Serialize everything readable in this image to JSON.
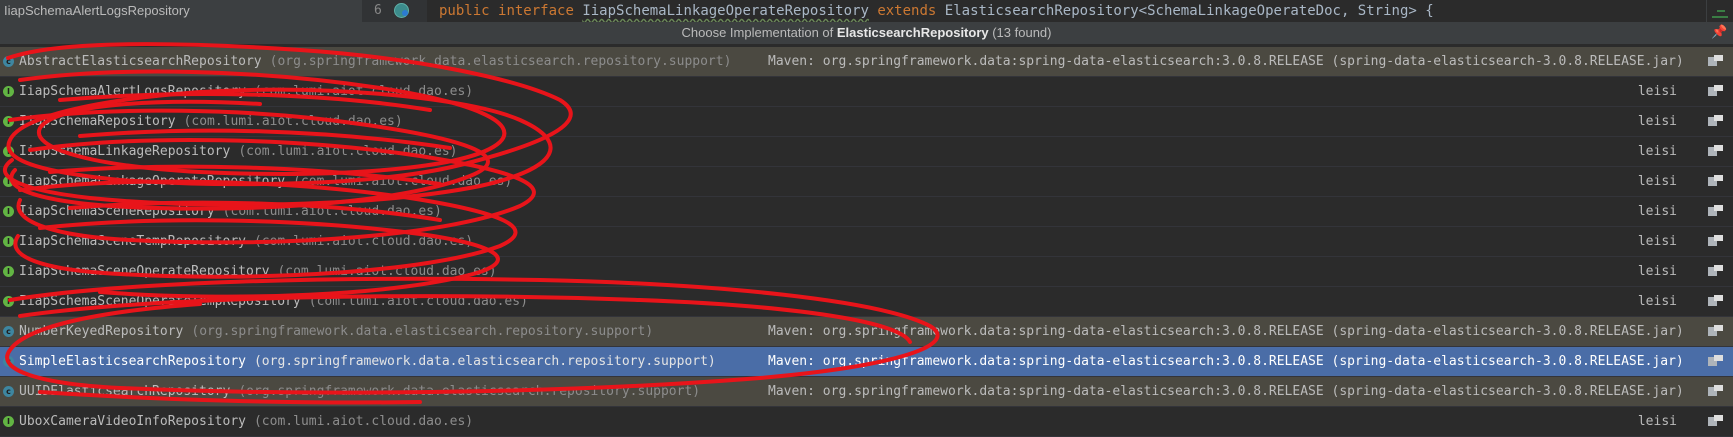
{
  "editor": {
    "file_tab": "IiapSchemaAlertLogsRepository",
    "line_number": "6",
    "code": {
      "kw1": "public",
      "kw2": "interface",
      "interface_name": "IiapSchemaLinkageOperateRepository",
      "kw3": "extends",
      "parent": "ElasticsearchRepository",
      "generic": "<SchemaLinkageOperateDoc, String>",
      "brace": " {"
    }
  },
  "popup": {
    "title_prefix": "Choose Implementation of ",
    "title_target": "ElasticsearchRepository",
    "title_count": " (13 found)"
  },
  "rows": [
    {
      "kind": "class",
      "name": "AbstractElasticsearchRepository",
      "pkg": "(org.springframework.data.elasticsearch.repository.support)",
      "location": "Maven: org.springframework.data:spring-data-elasticsearch:3.0.8.RELEASE (spring-data-elasticsearch-3.0.8.RELEASE.jar)",
      "library": true,
      "selected": false
    },
    {
      "kind": "interface",
      "name": "IiapSchemaAlertLogsRepository",
      "pkg": "(com.lumi.aiot.cloud.dao.es)",
      "module": "leisi",
      "library": false,
      "selected": false
    },
    {
      "kind": "interface",
      "name": "IiapSchemaRepository",
      "pkg": "(com.lumi.aiot.cloud.dao.es)",
      "module": "leisi",
      "library": false,
      "selected": false
    },
    {
      "kind": "interface",
      "name": "IiapSchemaLinkageRepository",
      "pkg": "(com.lumi.aiot.cloud.dao.es)",
      "module": "leisi",
      "library": false,
      "selected": false
    },
    {
      "kind": "interface",
      "name": "IiapSchemaLinkageOperateRepository",
      "pkg": "(com.lumi.aiot.cloud.dao.es)",
      "module": "leisi",
      "library": false,
      "selected": false
    },
    {
      "kind": "interface",
      "name": "IiapSchemaSceneRepository",
      "pkg": "(com.lumi.aiot.cloud.dao.es)",
      "module": "leisi",
      "library": false,
      "selected": false
    },
    {
      "kind": "interface",
      "name": "IiapSchemaSceneTempRepository",
      "pkg": "(com.lumi.aiot.cloud.dao.es)",
      "module": "leisi",
      "library": false,
      "selected": false
    },
    {
      "kind": "interface",
      "name": "IiapSchemaSceneOperateRepository",
      "pkg": "(com.lumi.aiot.cloud.dao.es)",
      "module": "leisi",
      "library": false,
      "selected": false
    },
    {
      "kind": "interface",
      "name": "IiapSchemaSceneOperateTempRepository",
      "pkg": "(com.lumi.aiot.cloud.dao.es)",
      "module": "leisi",
      "library": false,
      "selected": false
    },
    {
      "kind": "class",
      "name": "NumberKeyedRepository",
      "pkg": "(org.springframework.data.elasticsearch.repository.support)",
      "location": "Maven: org.springframework.data:spring-data-elasticsearch:3.0.8.RELEASE (spring-data-elasticsearch-3.0.8.RELEASE.jar)",
      "library": true,
      "selected": false
    },
    {
      "kind": "class",
      "name": "SimpleElasticsearchRepository",
      "pkg": "(org.springframework.data.elasticsearch.repository.support)",
      "location": "Maven: org.springframework.data:spring-data-elasticsearch:3.0.8.RELEASE (spring-data-elasticsearch-3.0.8.RELEASE.jar)",
      "library": true,
      "selected": true
    },
    {
      "kind": "class",
      "name": "UUIDElasticsearchRepository",
      "pkg": "(org.springframework.data.elasticsearch.repository.support)",
      "location": "Maven: org.springframework.data:spring-data-elasticsearch:3.0.8.RELEASE (spring-data-elasticsearch-3.0.8.RELEASE.jar)",
      "library": true,
      "selected": false
    },
    {
      "kind": "interface",
      "name": "UboxCameraVideoInfoRepository",
      "pkg": "(com.lumi.aiot.cloud.dao.es)",
      "module": "leisi",
      "library": false,
      "selected": false
    }
  ],
  "colors": {
    "editor_bg": "#2b2b2b",
    "library_row_bg": "#4b4941",
    "selected_row_bg": "#4a6da7",
    "keyword": "#cc7832",
    "annotation_red": "#e8141a"
  }
}
